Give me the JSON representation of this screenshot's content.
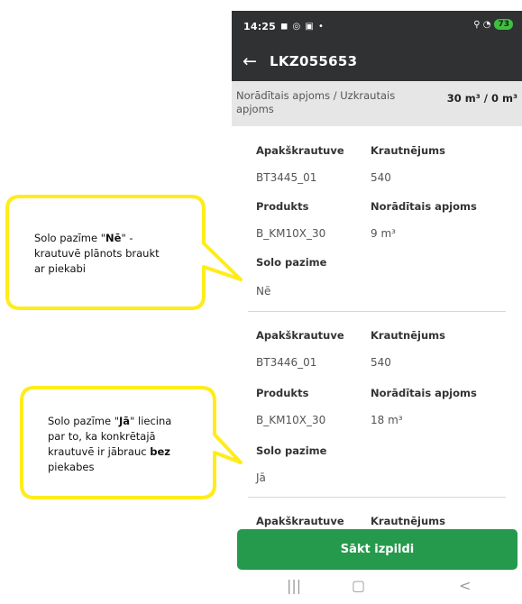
{
  "status_bar": {
    "time": "14:25",
    "icons_left": "◼ ◎ ▣ •",
    "icons_right": "⚲ ◔",
    "battery": "73"
  },
  "app_bar": {
    "title": "LKZ055653"
  },
  "summary": {
    "label": "Norādītais apjoms / Uzkrautais apjoms",
    "value": "30 m³ / 0 m³"
  },
  "cards": [
    {
      "apaks_label": "Apakškrautuve",
      "apaks_value": "BT3445_01",
      "kraut_label": "Krautnējums",
      "kraut_value": "540",
      "produkts_label": "Produkts",
      "produkts_value": "B_KM10X_30",
      "apjoms_label": "Norādītais apjoms",
      "apjoms_value": "9 m³",
      "solo_label": "Solo pazime",
      "solo_value": "Nē"
    },
    {
      "apaks_label": "Apakškrautuve",
      "apaks_value": "BT3446_01",
      "kraut_label": "Krautnējums",
      "kraut_value": "540",
      "produkts_label": "Produkts",
      "produkts_value": "B_KM10X_30",
      "apjoms_label": "Norādītais apjoms",
      "apjoms_value": "18 m³",
      "solo_label": "Solo pazime",
      "solo_value": "Jā"
    },
    {
      "apaks_label": "Apakškrautuve",
      "kraut_label": "Krautnējums"
    }
  ],
  "start_button": "Sākt izpildi",
  "nav": {
    "recent": "|||",
    "home": "▢",
    "back": "<"
  },
  "callouts": {
    "first": {
      "l1a": "Solo pazīme \"",
      "l1b": "Nē",
      "l1c": "\" -",
      "l2": "krautuvē plānots braukt",
      "l3": "ar piekabi"
    },
    "second": {
      "l1a": "Solo pazīme \"",
      "l1b": "Jā",
      "l1c": "\" liecina",
      "l2": "par to, ka konkrētajā",
      "l3a": "krautuvē ir jābrauc ",
      "l3b": "bez",
      "l4": "piekabes"
    }
  },
  "colors": {
    "appbar": "#2f3133",
    "summary_bg": "#e6e6e6",
    "button": "#259a4c",
    "callout_border": "#ffec1a"
  }
}
